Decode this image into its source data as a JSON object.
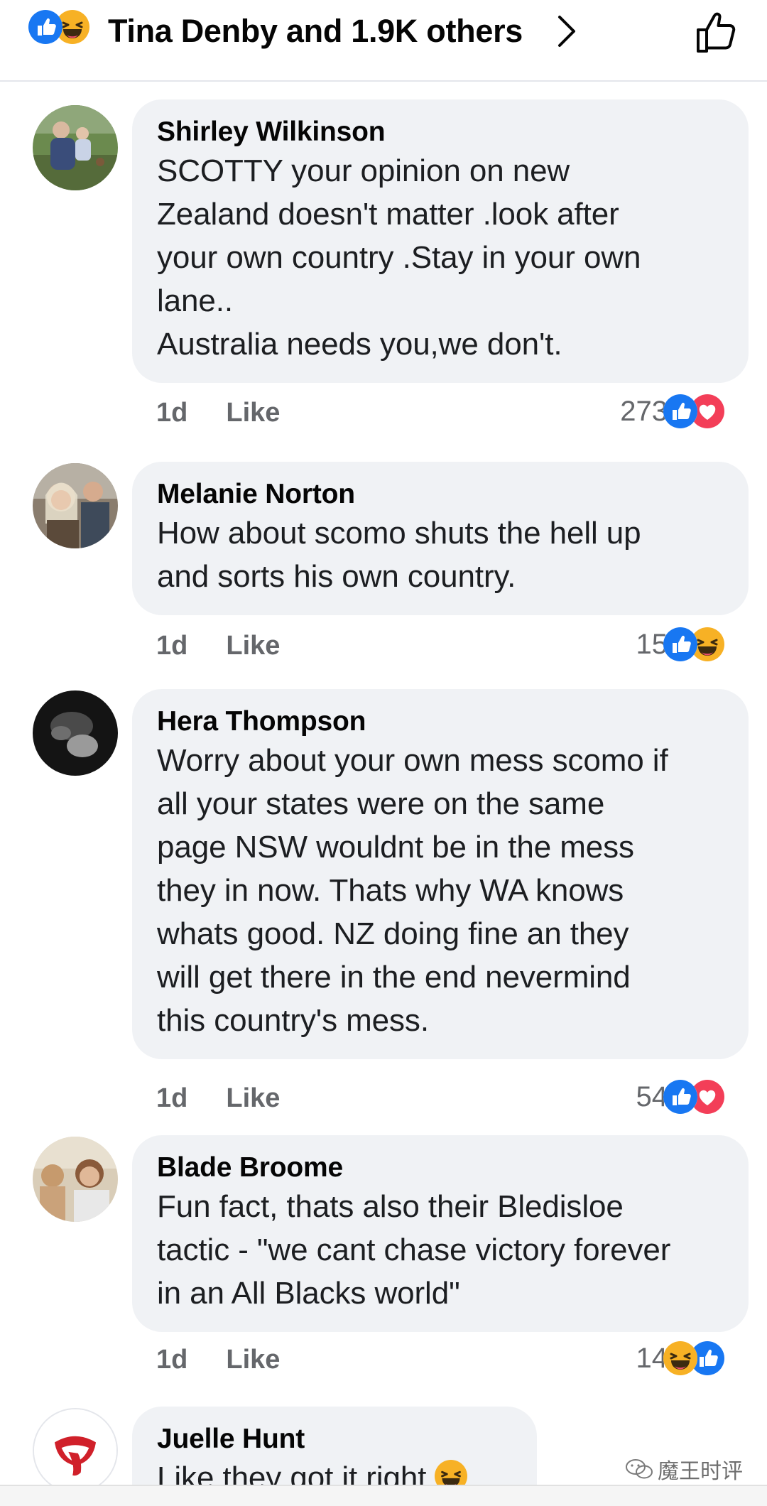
{
  "header": {
    "title": "Tina Denby and 1.9K others",
    "reactions": [
      "like-icon",
      "haha-icon"
    ]
  },
  "comments": [
    {
      "author": "Shirley Wilkinson",
      "text": "SCOTTY your opinion on new\nZealand doesn't matter .look after\nyour own country .Stay in your own\nlane..\nAustralia needs you,we don't.",
      "time": "1d",
      "like_label": "Like",
      "reaction_count": "273",
      "reactions": [
        "like-icon",
        "love-icon"
      ]
    },
    {
      "author": "Melanie Norton",
      "text": "How about scomo shuts the hell up\nand sorts his own country.",
      "time": "1d",
      "like_label": "Like",
      "reaction_count": "15",
      "reactions": [
        "like-icon",
        "haha-icon"
      ]
    },
    {
      "author": "Hera Thompson",
      "text": "Worry about your own mess scomo if\nall your states were on the same\npage NSW wouldnt be in the mess\nthey in now. Thats why WA knows\nwhats good. NZ doing fine an they\nwill get there in the end nevermind\nthis country's mess.",
      "time": "1d",
      "like_label": "Like",
      "reaction_count": "54",
      "reactions": [
        "like-icon",
        "love-icon"
      ]
    },
    {
      "author": "Blade Broome",
      "text": "Fun fact, thats also their Bledisloe\ntactic - \"we cant chase victory forever\nin an All Blacks world\"",
      "time": "1d",
      "like_label": "Like",
      "reaction_count": "14",
      "reactions": [
        "haha-icon",
        "like-icon"
      ]
    },
    {
      "author": "Juelle Hunt",
      "text": "Like they got it right"
    }
  ],
  "watermark": "魔王时评",
  "colors": {
    "like_blue": "#1877f2",
    "love_red": "#f33e58",
    "haha_yellow": "#f7b125",
    "bubble_bg": "#f0f2f5",
    "meta_gray": "#65676b"
  }
}
